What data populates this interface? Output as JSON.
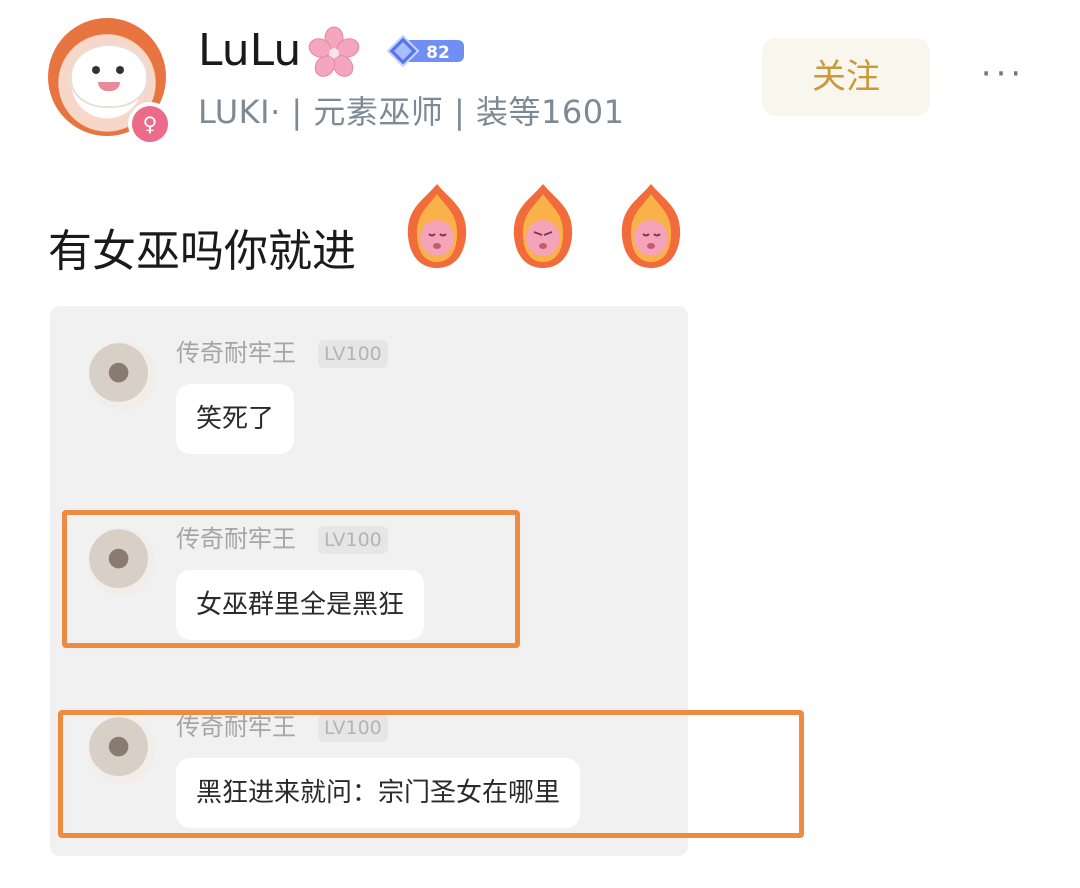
{
  "header": {
    "username": "LuLu",
    "subtitle": "LUKI· | 元素巫师 | 装等1601",
    "follow_label": "关注",
    "more_label": "···",
    "level_badge_text": "82"
  },
  "post": {
    "text": "有女巫吗你就进"
  },
  "chat": {
    "messages": [
      {
        "name": "传奇耐牢王",
        "level": "LV100",
        "text": "笑死了"
      },
      {
        "name": "传奇耐牢王",
        "level": "LV100",
        "text": "女巫群里全是黑狂"
      },
      {
        "name": "传奇耐牢王",
        "level": "LV100",
        "text": "黑狂进来就问：宗门圣女在哪里"
      }
    ]
  },
  "colors": {
    "follow_text": "#c89a3a",
    "follow_bg": "#f8f6ed",
    "highlight_border": "#ef8b40",
    "subtitle": "#7d8a96"
  },
  "icons": {
    "flower": "cherry-blossom-icon",
    "badge": "level-badge-icon",
    "avatar_badge": "female-symbol-icon",
    "stickers": [
      "fire-bunny-sticker",
      "fire-bunny-sticker",
      "fire-bunny-sticker"
    ]
  }
}
